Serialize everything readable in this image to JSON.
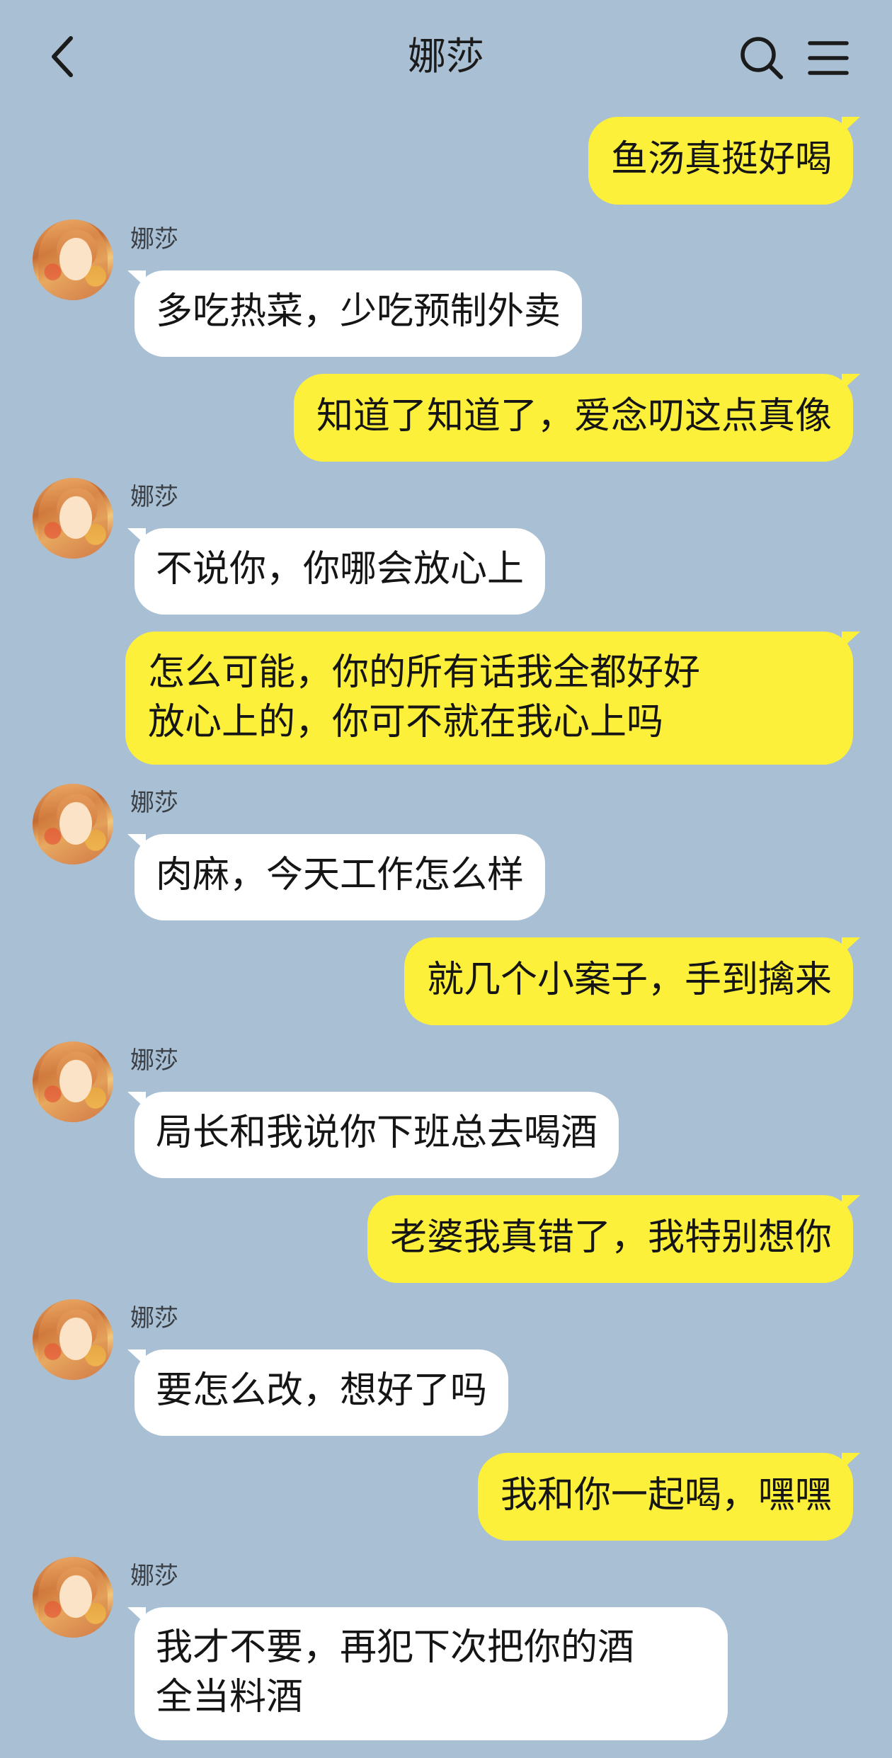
{
  "header": {
    "title": "娜莎"
  },
  "contact": {
    "name": "娜莎"
  },
  "messages": [
    {
      "dir": "out",
      "text": "鱼汤真挺好喝"
    },
    {
      "dir": "in",
      "sender": "娜莎",
      "text": "多吃热菜，少吃预制外卖"
    },
    {
      "dir": "out",
      "text": "知道了知道了，爱念叨这点真像"
    },
    {
      "dir": "in",
      "sender": "娜莎",
      "text": "不说你，你哪会放心上"
    },
    {
      "dir": "out",
      "text": "怎么可能，你的所有话我全都好好放心上的，你可不就在我心上吗",
      "line1": "怎么可能，你的所有话我全都好好",
      "line2": "放心上的，你可不就在我心上吗"
    },
    {
      "dir": "in",
      "sender": "娜莎",
      "text": "肉麻，今天工作怎么样"
    },
    {
      "dir": "out",
      "text": "就几个小案子，手到擒来"
    },
    {
      "dir": "in",
      "sender": "娜莎",
      "text": "局长和我说你下班总去喝酒"
    },
    {
      "dir": "out",
      "text": "老婆我真错了，我特别想你"
    },
    {
      "dir": "in",
      "sender": "娜莎",
      "text": "要怎么改，想好了吗"
    },
    {
      "dir": "out",
      "text": "我和你一起喝，嘿嘿"
    },
    {
      "dir": "in",
      "sender": "娜莎",
      "text": "我才不要，再犯下次把你的酒全当料酒",
      "line1": "我才不要，再犯下次把你的酒",
      "line2": "全当料酒"
    }
  ],
  "icons": {
    "back": "chevron-left-icon",
    "search": "search-icon",
    "menu": "menu-icon"
  },
  "colors": {
    "background": "#a9bfd3",
    "outgoing": "#fdf03b",
    "incoming": "#ffffff"
  }
}
